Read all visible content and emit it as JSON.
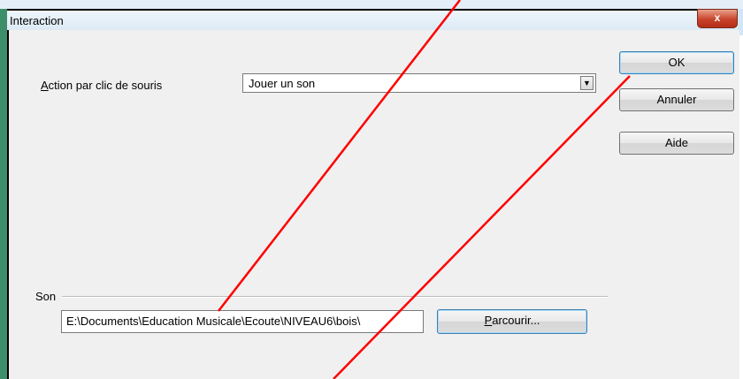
{
  "dialog": {
    "title": "Interaction",
    "close_label": "x"
  },
  "action": {
    "label_first": "A",
    "label_rest": "ction par clic de souris",
    "selected_value": "Jouer un son",
    "arrow_icon": "dropdown-arrow-icon"
  },
  "buttons": {
    "ok": "OK",
    "cancel": "Annuler",
    "help": "Aide",
    "browse_first": "P",
    "browse_rest": "arcourir..."
  },
  "sound": {
    "group_label": "Son",
    "path_value": "E:\\Documents\\Education Musicale\\Ecoute\\NIVEAU6\\bois\\"
  },
  "annotations": {
    "color": "#ff0000"
  }
}
